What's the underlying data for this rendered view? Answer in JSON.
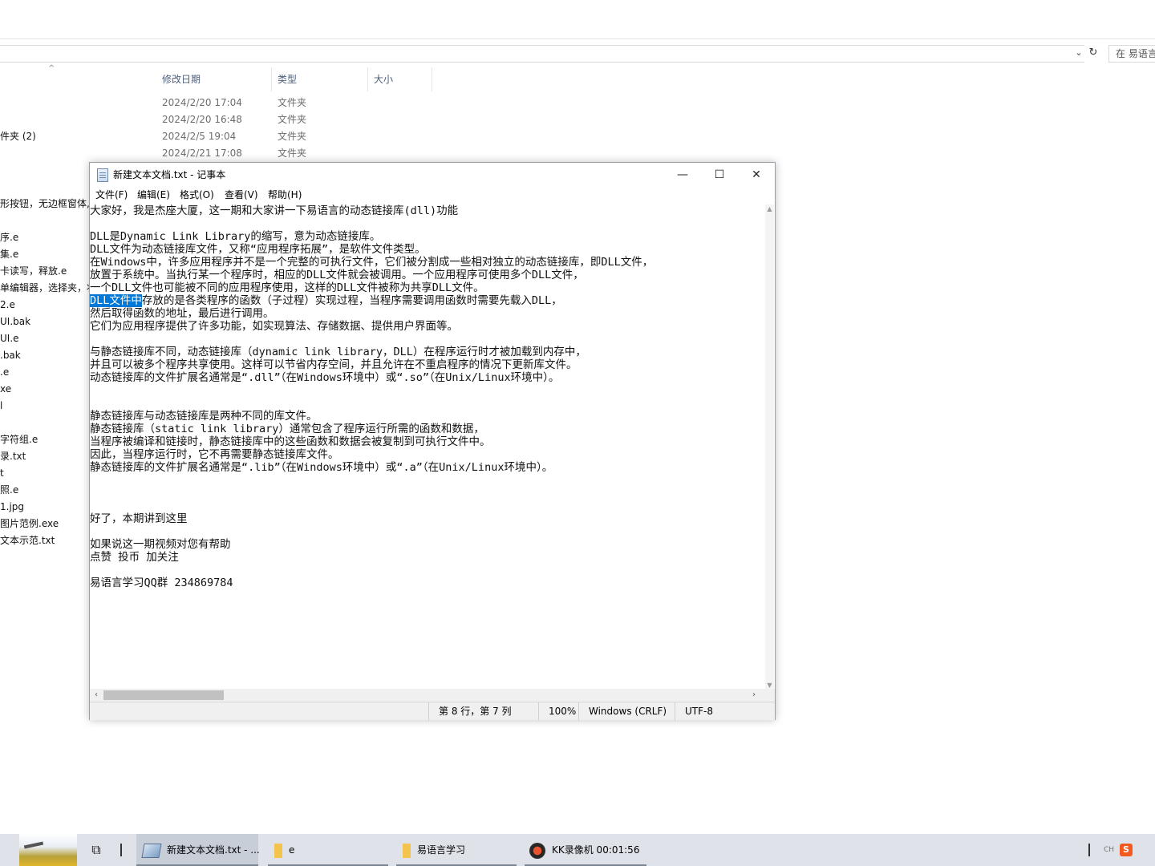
{
  "explorer": {
    "search_placeholder": "在 易语言学习",
    "columns": {
      "modified": "修改日期",
      "type": "类型",
      "size": "大小"
    },
    "folder_rows": [
      {
        "date": "2024/2/20 17:04",
        "type": "文件夹"
      },
      {
        "date": "2024/2/20 16:48",
        "type": "文件夹"
      },
      {
        "date": "2024/2/5 19:04",
        "type": "文件夹"
      },
      {
        "date": "2024/2/21 17:08",
        "type": "文件夹"
      }
    ],
    "names": {
      "n1": "件夹 (2)",
      "n2": "形按钮，无边框窗体,",
      "n3": "序.e",
      "n4": "集.e",
      "n5": "卡读写，释放.e",
      "n6": "单编辑器，选择夹，状",
      "n7": "2.e",
      "n8": "UI.bak",
      "n9": "UI.e",
      "n10": ".bak",
      "n11": ".e",
      "n12": "xe",
      "n13": "l",
      "n14": "字符组.e",
      "n15": "录.txt",
      "n16": "t",
      "n17": "照.e",
      "n18": "1.jpg",
      "n19": "图片范例.exe",
      "n20": "文本示范.txt"
    }
  },
  "notepad": {
    "title": "新建文本文档.txt - 记事本",
    "window_buttons": {
      "minimize": "—",
      "maximize": "☐",
      "close": "✕"
    },
    "menu": {
      "file": "文件(F)",
      "edit": "编辑(E)",
      "format": "格式(O)",
      "view": "查看(V)",
      "help": "帮助(H)"
    },
    "text": {
      "l1": "大家好，我是杰座大厦，这一期和大家讲一下易语言的动态链接库(dll)功能",
      "l2": "",
      "l3": "DLL是Dynamic Link Library的缩写，意为动态链接库。",
      "l4": "DLL文件为动态链接库文件，又称“应用程序拓展”，是软件文件类型。",
      "l5": "在Windows中，许多应用程序并不是一个完整的可执行文件，它们被分割成一些相对独立的动态链接库，即DLL文件，",
      "l6": "放置于系统中。当执行某一个程序时，相应的DLL文件就会被调用。一个应用程序可使用多个DLL文件，",
      "l7": "一个DLL文件也可能被不同的应用程序使用，这样的DLL文件被称为共享DLL文件。",
      "l8_selected": "DLL文件中",
      "l8_rest": "存放的是各类程序的函数（子过程）实现过程，当程序需要调用函数时需要先载入DLL，",
      "l9": "然后取得函数的地址，最后进行调用。",
      "l10": "它们为应用程序提供了许多功能，如实现算法、存储数据、提供用户界面等。",
      "l11": "",
      "l12": "与静态链接库不同，动态链接库（dynamic link library，DLL）在程序运行时才被加载到内存中，",
      "l13": "并且可以被多个程序共享使用。这样可以节省内存空间，并且允许在不重启程序的情况下更新库文件。",
      "l14": "动态链接库的文件扩展名通常是“.dll”（在Windows环境中）或“.so”（在Unix/Linux环境中）。",
      "l15": "",
      "l16": "",
      "l17": "静态链接库与动态链接库是两种不同的库文件。",
      "l18": "静态链接库（static link library）通常包含了程序运行所需的函数和数据，",
      "l19": "当程序被编译和链接时，静态链接库中的这些函数和数据会被复制到可执行文件中。",
      "l20": "因此，当程序运行时，它不再需要静态链接库文件。",
      "l21": "静态链接库的文件扩展名通常是“.lib”（在Windows环境中）或“.a”（在Unix/Linux环境中）。",
      "l22": "",
      "l23": "",
      "l24": "",
      "l25": "好了，本期讲到这里",
      "l26": "",
      "l27": "如果说这一期视频对您有帮助",
      "l28": "点赞 投币 加关注",
      "l29": "",
      "l30": "易语言学习QQ群 234869784"
    },
    "status": {
      "position": "第 8 行，第 7 列",
      "zoom": "100%",
      "line_ending": "Windows (CRLF)",
      "encoding": "UTF-8"
    }
  },
  "taskbar": {
    "apps": [
      {
        "label": "新建文本文档.txt - ...",
        "icon": "notepad-icon"
      },
      {
        "label": "e",
        "icon": "folder-icon"
      },
      {
        "label": "易语言学习",
        "icon": "folder-icon"
      },
      {
        "label": "KK录像机 00:01:56",
        "icon": "kk-recorder-icon"
      }
    ],
    "tray": {
      "lang": "CH",
      "ime": "S"
    }
  }
}
